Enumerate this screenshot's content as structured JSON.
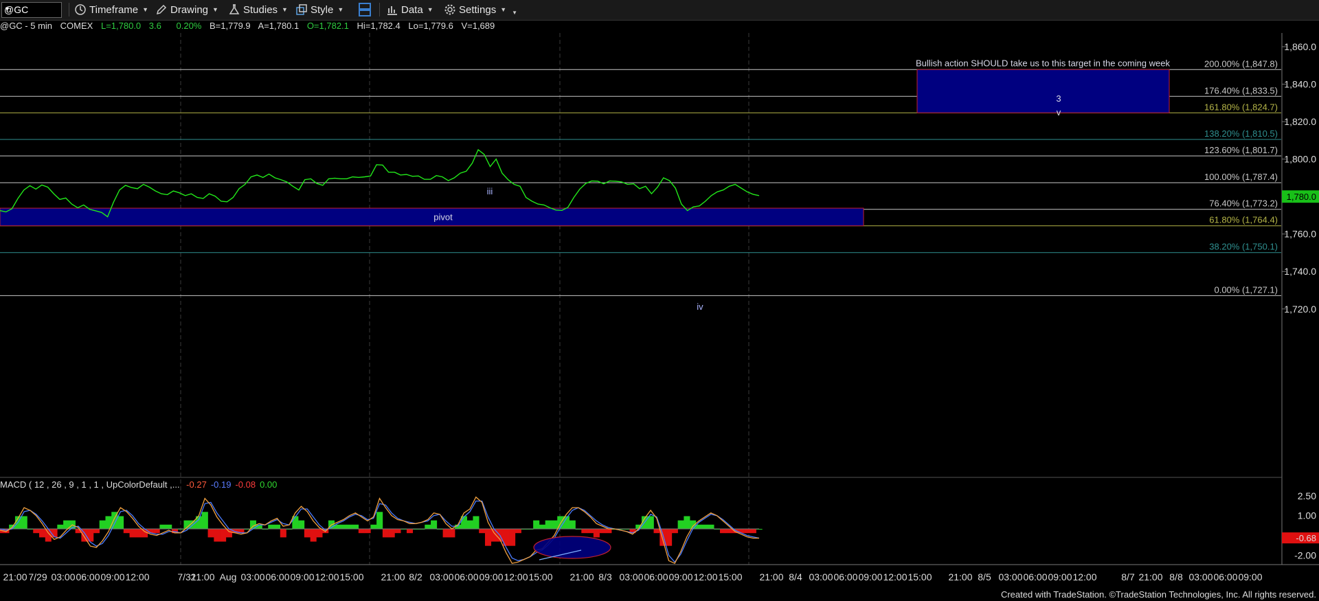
{
  "toolbar": {
    "symbol": "@GC",
    "items": [
      {
        "label": "Timeframe",
        "icon": "clock-icon"
      },
      {
        "label": "Drawing",
        "icon": "pencil-icon"
      },
      {
        "label": "Studies",
        "icon": "flask-icon"
      },
      {
        "label": "Style",
        "icon": "style-icon"
      },
      {
        "label": "",
        "icon": "layout-icon"
      },
      {
        "label": "Data",
        "icon": "bar-chart-icon"
      },
      {
        "label": "Settings",
        "icon": "gear-icon"
      }
    ]
  },
  "quote": {
    "symbol": "@GC - 5 min",
    "exchange": "COMEX",
    "last": "L=1,780.0",
    "change": "3.6",
    "pct": "0.20%",
    "bid": "B=1,779.9",
    "ask": "A=1,780.1",
    "open": "O=1,782.1",
    "high": "Hi=1,782.4",
    "low": "Lo=1,779.6",
    "volume": "V=1,689"
  },
  "chart_data": {
    "type": "line",
    "price_axis": {
      "ticks": [
        "1,860.0",
        "1,840.0",
        "1,820.0",
        "1,800.0",
        "1,780.0",
        "1,760.0",
        "1,740.0",
        "1,720.0"
      ],
      "ylim": [
        1715,
        1864
      ],
      "current": "1,780.0"
    },
    "time_axis": {
      "ticks": [
        "21:00",
        "7/29",
        "03:00",
        "06:00",
        "09:00",
        "12:00",
        "7/31",
        "21:00",
        "Aug",
        "03:00",
        "06:00",
        "09:00",
        "12:00",
        "15:00",
        "21:00",
        "8/2",
        "03:00",
        "06:00",
        "09:00",
        "12:00",
        "15:00",
        "21:00",
        "8/3",
        "03:00",
        "06:00",
        "09:00",
        "12:00",
        "15:00",
        "21:00",
        "8/4",
        "03:00",
        "06:00",
        "09:00",
        "12:00",
        "15:00",
        "21:00",
        "8/5",
        "03:00",
        "06:00",
        "09:00",
        "12:00",
        "8/7",
        "21:00",
        "8/8",
        "03:00",
        "06:00",
        "09:00"
      ]
    },
    "fib_levels": [
      {
        "label": "200.00% (1,847.8)",
        "value": 1847.8,
        "color": "#c8c8c8"
      },
      {
        "label": "176.40% (1,833.5)",
        "value": 1833.5,
        "color": "#c8c8c8"
      },
      {
        "label": "161.80% (1,824.7)",
        "value": 1824.7,
        "color": "#b5b548"
      },
      {
        "label": "138.20% (1,810.5)",
        "value": 1810.5,
        "color": "#2f8f8f"
      },
      {
        "label": "123.60% (1,801.7)",
        "value": 1801.7,
        "color": "#c8c8c8"
      },
      {
        "label": "100.00% (1,787.4)",
        "value": 1787.4,
        "color": "#c8c8c8"
      },
      {
        "label": "76.40% (1,773.2)",
        "value": 1773.2,
        "color": "#c8c8c8"
      },
      {
        "label": "61.80% (1,764.4)",
        "value": 1764.4,
        "color": "#b5b548"
      },
      {
        "label": "38.20% (1,750.1)",
        "value": 1750.1,
        "color": "#2f8f8f"
      },
      {
        "label": "0.00% (1,727.1)",
        "value": 1727.1,
        "color": "#c8c8c8"
      }
    ],
    "zones": [
      {
        "name": "pivot",
        "label": "pivot",
        "low": 1764.4,
        "high": 1773.8
      },
      {
        "name": "target",
        "label": "Bullish action SHOULD take us to this target in the coming week",
        "low": 1824.7,
        "high": 1847.8
      }
    ],
    "wave_labels": [
      "iii",
      "iv",
      "3",
      "v"
    ],
    "price_series": [
      1772.5,
      1771.8,
      1773.5,
      1779,
      1783.5,
      1785.8,
      1784,
      1786.2,
      1785,
      1781.5,
      1778.5,
      1779.2,
      1776,
      1774,
      1775.5,
      1773.2,
      1772.4,
      1771.5,
      1769.2,
      1777,
      1783.5,
      1786,
      1784.8,
      1784.2,
      1786.5,
      1785,
      1783,
      1781.5,
      1781,
      1783,
      1782,
      1780.5,
      1781.5,
      1779.5,
      1779,
      1781.5,
      1780.2,
      1777.5,
      1777.2,
      1779.5,
      1784.2,
      1786.5,
      1790.5,
      1791.5,
      1790.2,
      1792,
      1790,
      1789,
      1787.8,
      1785.5,
      1783.5,
      1789,
      1789.5,
      1787,
      1786,
      1789.5,
      1789.8,
      1789.5,
      1789.5,
      1790.5,
      1790.2,
      1790.5,
      1791,
      1797,
      1796.8,
      1793,
      1793,
      1791.5,
      1791.8,
      1790.8,
      1791,
      1789.2,
      1789.2,
      1791.2,
      1790.5,
      1788.5,
      1790,
      1792.5,
      1793.5,
      1797.8,
      1805,
      1802.5,
      1796,
      1800,
      1792.5,
      1789,
      1786.5,
      1785.5,
      1779.5,
      1777.5,
      1776,
      1775.5,
      1774,
      1772.8,
      1772.6,
      1774.2,
      1779.5,
      1784,
      1787,
      1788.3,
      1788.2,
      1786.8,
      1788.3,
      1788.2,
      1787.8,
      1786.5,
      1786.8,
      1784.2,
      1785.5,
      1781.5,
      1785,
      1790,
      1788.5,
      1784.5,
      1776,
      1772.5,
      1774.5,
      1775,
      1777.5,
      1780.5,
      1782.5,
      1783.5,
      1785.5,
      1786.5,
      1784.5,
      1782.5,
      1781.2,
      1780.5
    ],
    "macd": {
      "label": "MACD ( 12 , 26 , 9 , 1 , 1 , UpColorDefault ,...",
      "values": [
        "-0.27",
        "-0.19",
        "-0.08",
        "0.00"
      ],
      "ticks": [
        "2.50",
        "1.00",
        "-2.00"
      ],
      "ylim": [
        -2.8,
        3.0
      ],
      "current": "-0.68",
      "macd_series": [
        -0.1,
        -0.2,
        0.1,
        0.8,
        1.6,
        1.4,
        1.0,
        0.4,
        -0.3,
        -0.8,
        -0.6,
        -0.1,
        0.3,
        0.1,
        -0.6,
        -1.3,
        -1.4,
        -0.9,
        -0.2,
        0.8,
        1.6,
        1.3,
        0.8,
        0.2,
        -0.2,
        -0.4,
        -0.5,
        -0.3,
        -0.1,
        -0.3,
        -0.3,
        0.1,
        0.5,
        1.0,
        2.3,
        1.8,
        0.9,
        0.3,
        -0.2,
        -0.3,
        -0.4,
        -0.3,
        0.2,
        0.4,
        0.3,
        0.6,
        0.8,
        0.2,
        0.3,
        1.2,
        1.7,
        1.3,
        0.6,
        0.1,
        -0.2,
        0.3,
        0.5,
        0.7,
        1.0,
        1.2,
        0.9,
        0.6,
        0.9,
        2.3,
        1.6,
        1.0,
        0.7,
        0.6,
        0.4,
        0.4,
        0.5,
        0.7,
        1.2,
        1.1,
        0.4,
        0.0,
        0.3,
        1.2,
        1.5,
        2.4,
        2.0,
        0.5,
        -0.3,
        -0.8,
        -1.8,
        -2.6,
        -2.5,
        -2.3,
        -2.1,
        -1.6,
        -1.5,
        -1.0,
        -0.5,
        0.4,
        1.1,
        1.6,
        1.6,
        1.3,
        0.9,
        0.4,
        0.2,
        0.0,
        0.0,
        -0.1,
        -0.2,
        -0.4,
        0.0,
        0.8,
        1.4,
        0.8,
        -0.8,
        -2.4,
        -2.6,
        -1.7,
        -0.6,
        0.2,
        0.6,
        0.9,
        1.2,
        1.0,
        0.6,
        0.2,
        -0.2,
        -0.4,
        -0.6,
        -0.7,
        -0.7
      ],
      "signal_series": [
        0.0,
        -0.1,
        0.0,
        0.5,
        1.3,
        1.4,
        1.1,
        0.6,
        0.0,
        -0.6,
        -0.7,
        -0.3,
        0.1,
        0.2,
        -0.3,
        -1.0,
        -1.3,
        -1.1,
        -0.5,
        0.4,
        1.3,
        1.4,
        1.0,
        0.4,
        0.0,
        -0.3,
        -0.4,
        -0.4,
        -0.2,
        -0.2,
        -0.3,
        -0.1,
        0.3,
        0.7,
        1.9,
        2.0,
        1.2,
        0.6,
        0.0,
        -0.2,
        -0.3,
        -0.3,
        0.0,
        0.3,
        0.3,
        0.5,
        0.7,
        0.4,
        0.3,
        0.9,
        1.5,
        1.5,
        0.9,
        0.3,
        -0.1,
        0.1,
        0.4,
        0.6,
        0.9,
        1.1,
        1.0,
        0.7,
        0.8,
        1.9,
        1.8,
        1.2,
        0.8,
        0.6,
        0.5,
        0.4,
        0.5,
        0.6,
        1.0,
        1.1,
        0.6,
        0.2,
        0.2,
        0.9,
        1.3,
        2.1,
        2.1,
        0.9,
        0.0,
        -0.5,
        -1.4,
        -2.2,
        -2.4,
        -2.3,
        -2.1,
        -1.8,
        -1.6,
        -1.2,
        -0.7,
        0.1,
        0.8,
        1.4,
        1.6,
        1.4,
        1.0,
        0.6,
        0.3,
        0.1,
        0.0,
        -0.1,
        -0.2,
        -0.3,
        -0.1,
        0.5,
        1.1,
        0.9,
        -0.4,
        -2.0,
        -2.5,
        -1.9,
        -0.9,
        0.0,
        0.5,
        0.8,
        1.1,
        1.0,
        0.7,
        0.3,
        -0.1,
        -0.3,
        -0.5,
        -0.6,
        -0.7
      ]
    }
  },
  "footer": {
    "text": "Created with TradeStation. ©TradeStation Technologies, Inc. All rights reserved."
  }
}
